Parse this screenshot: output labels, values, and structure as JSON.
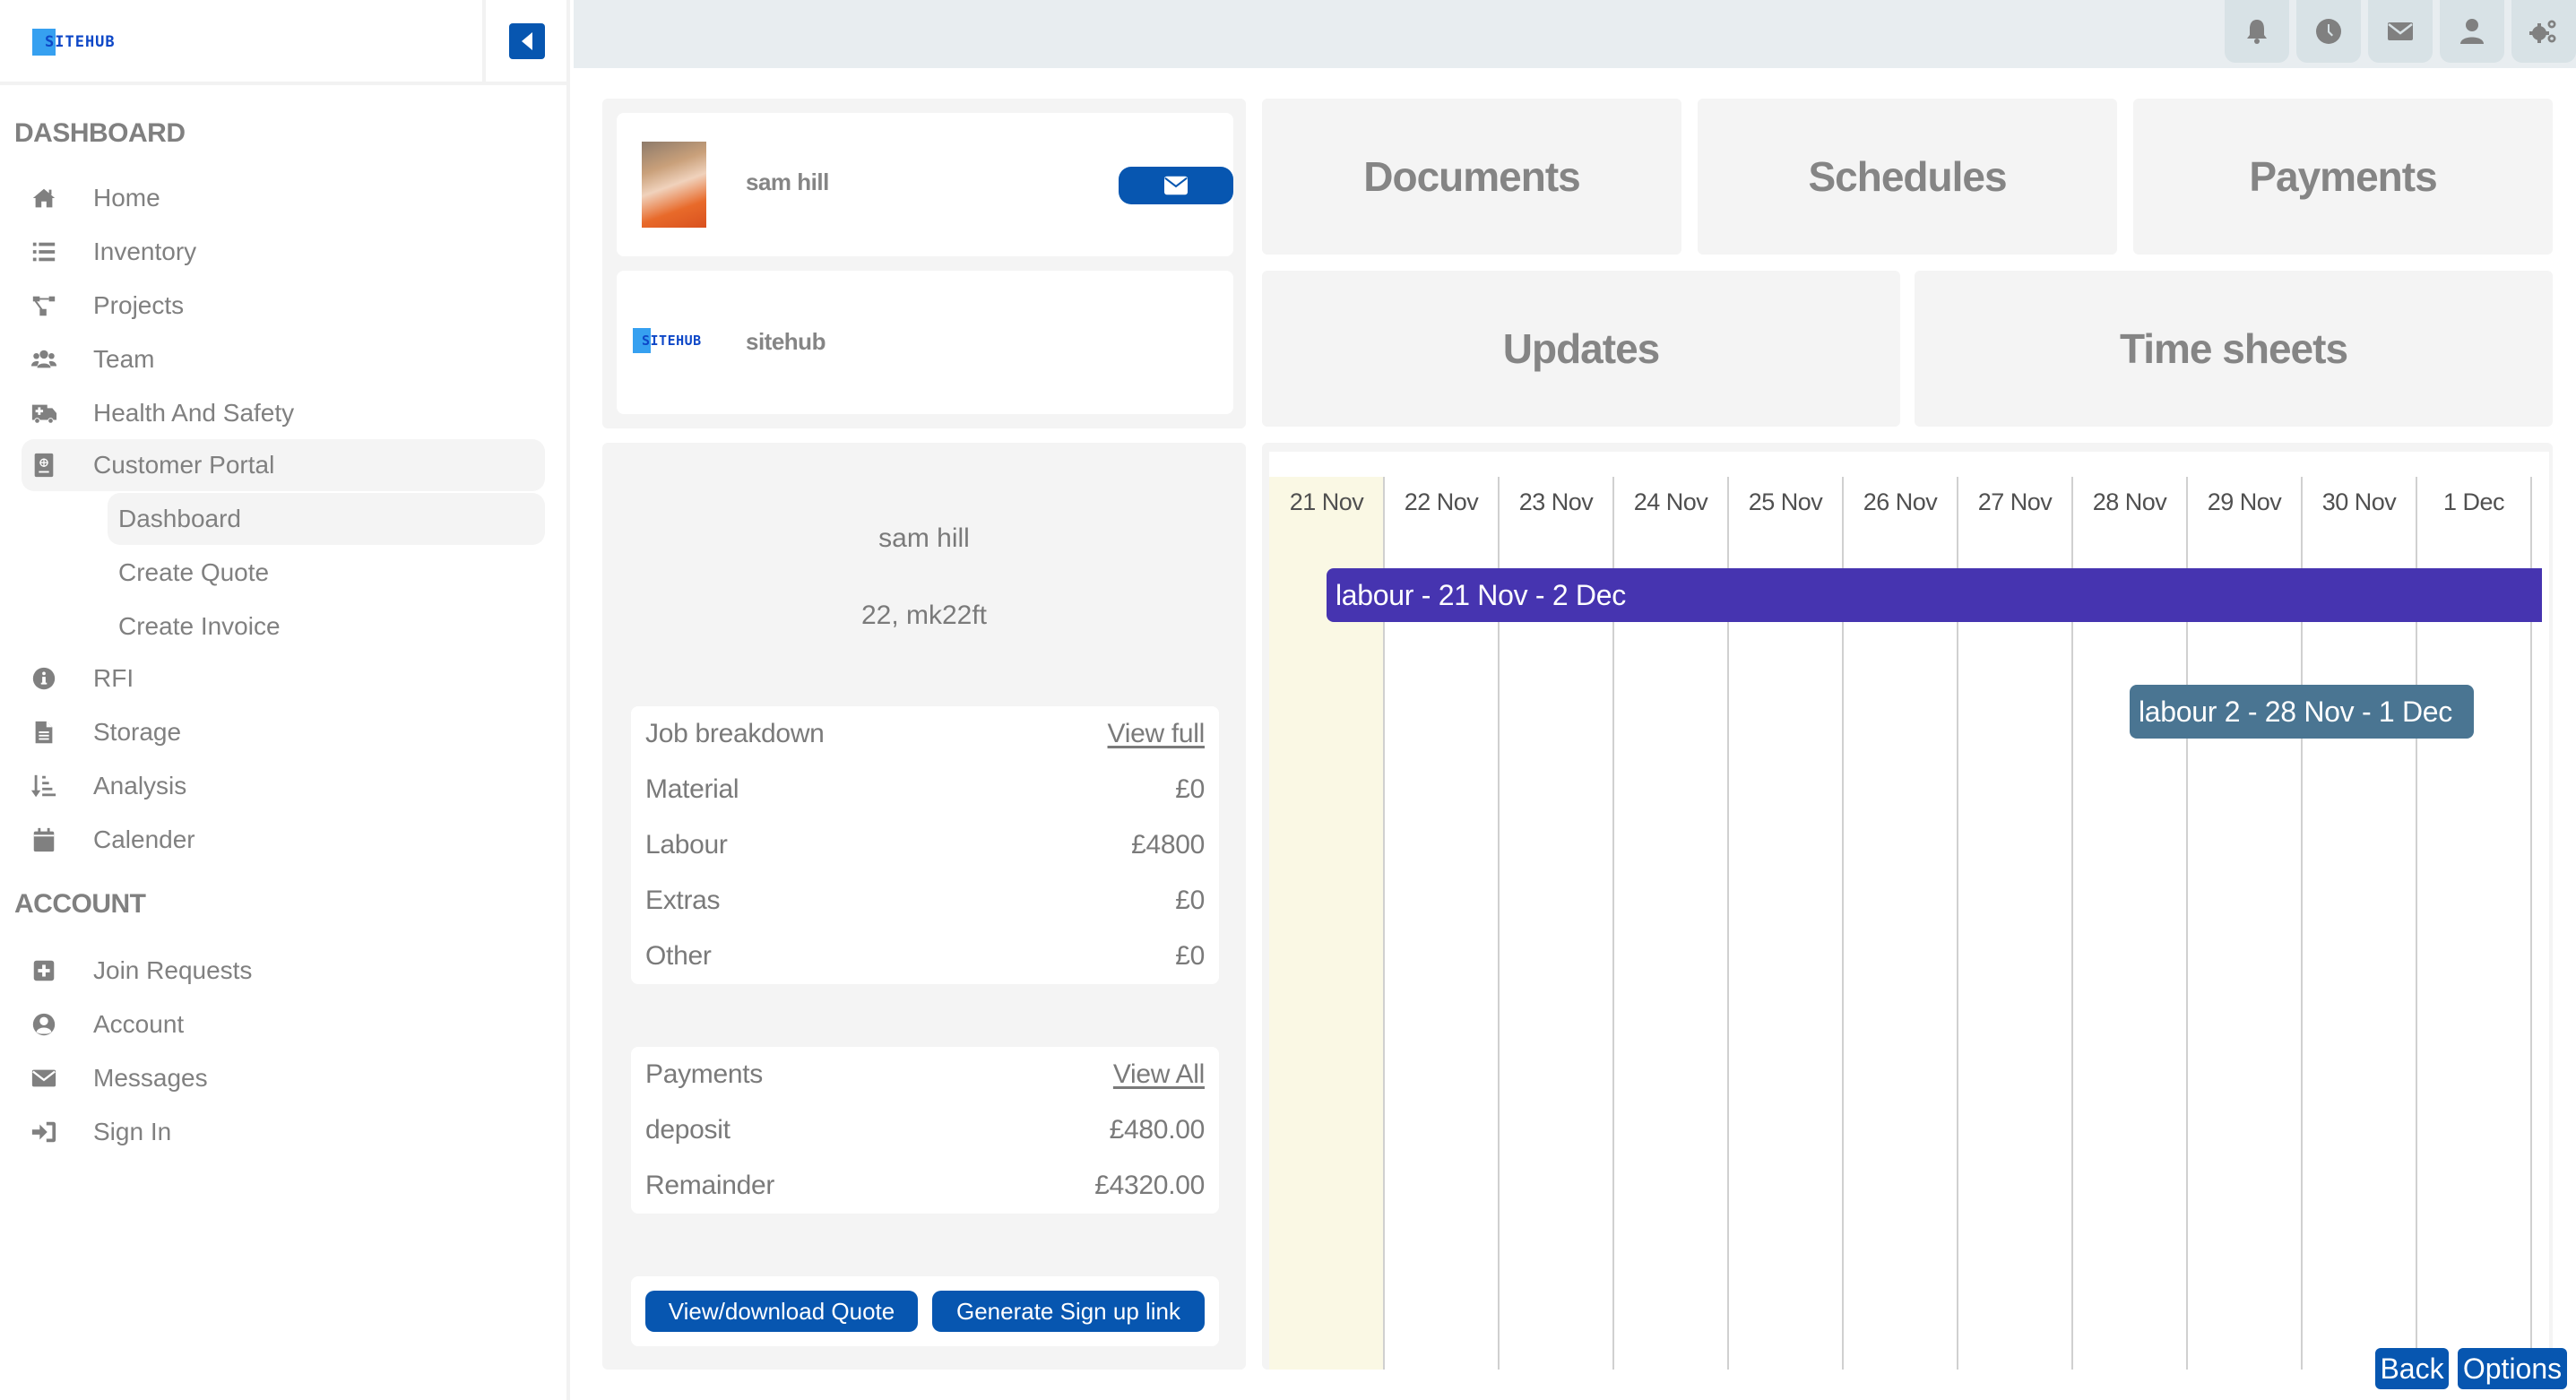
{
  "brand": {
    "logo_text": "SITEHUB",
    "primary_color": "#0756b0",
    "logo_accent": "#36a0f0"
  },
  "sidebar": {
    "collapse_icon": "caret-left-icon",
    "sections": [
      {
        "title": "DASHBOARD",
        "items": [
          {
            "label": "Home",
            "icon": "home-icon"
          },
          {
            "label": "Inventory",
            "icon": "list-icon"
          },
          {
            "label": "Projects",
            "icon": "project-diagram-icon"
          },
          {
            "label": "Team",
            "icon": "users-icon"
          },
          {
            "label": "Health And Safety",
            "icon": "ambulance-icon"
          },
          {
            "label": "Customer Portal",
            "icon": "passport-icon",
            "active": true,
            "children": [
              {
                "label": "Dashboard",
                "active": true
              },
              {
                "label": "Create Quote"
              },
              {
                "label": "Create Invoice"
              }
            ]
          },
          {
            "label": "RFI",
            "icon": "info-circle-icon"
          },
          {
            "label": "Storage",
            "icon": "file-icon"
          },
          {
            "label": "Analysis",
            "icon": "sort-amount-icon"
          },
          {
            "label": "Calender",
            "icon": "calendar-icon"
          }
        ]
      },
      {
        "title": "ACCOUNT",
        "items": [
          {
            "label": "Join Requests",
            "icon": "plus-square-icon"
          },
          {
            "label": "Account",
            "icon": "user-circle-icon"
          },
          {
            "label": "Messages",
            "icon": "envelope-icon"
          },
          {
            "label": "Sign In",
            "icon": "sign-in-icon"
          }
        ]
      }
    ]
  },
  "topbar": {
    "icons": [
      "bell-icon",
      "clock-icon",
      "envelope-icon",
      "user-icon",
      "cogs-icon"
    ]
  },
  "profile": {
    "customer_name": "sam hill",
    "company_name": "sitehub",
    "mail_icon": "envelope-icon"
  },
  "tiles": {
    "row1": [
      "Documents",
      "Schedules",
      "Payments"
    ],
    "row2": [
      "Updates",
      "Time sheets"
    ]
  },
  "summary": {
    "customer_name": "sam hill",
    "address": "22, mk22ft",
    "job_breakdown": {
      "title": "Job breakdown",
      "link": "View full",
      "rows": [
        {
          "label": "Material",
          "value": "£0"
        },
        {
          "label": "Labour",
          "value": "£4800"
        },
        {
          "label": "Extras",
          "value": "£0"
        },
        {
          "label": "Other",
          "value": "£0"
        }
      ]
    },
    "payments": {
      "title": "Payments",
      "link": "View All",
      "rows": [
        {
          "label": "deposit",
          "value": "£480.00"
        },
        {
          "label": "Remainder",
          "value": "£4320.00"
        }
      ]
    },
    "buttons": {
      "quote": "View/download Quote",
      "signup": "Generate Sign up link"
    }
  },
  "schedule": {
    "days": [
      "21 Nov",
      "22 Nov",
      "23 Nov",
      "24 Nov",
      "25 Nov",
      "26 Nov",
      "27 Nov",
      "28 Nov",
      "29 Nov",
      "30 Nov",
      "1 Dec"
    ],
    "today_index": 0,
    "today_color": "#faf8e4",
    "events": [
      {
        "label": "labour - 21 Nov - 2 Dec",
        "start_index": 0.5,
        "end_index": 11.6,
        "color": "#4634b0"
      },
      {
        "label": "labour 2 - 28 Nov - 1 Dec",
        "start_index": 7.5,
        "end_index": 10.5,
        "color": "#4a7592"
      }
    ]
  },
  "footer_buttons": {
    "back": "Back",
    "options": "Options"
  }
}
